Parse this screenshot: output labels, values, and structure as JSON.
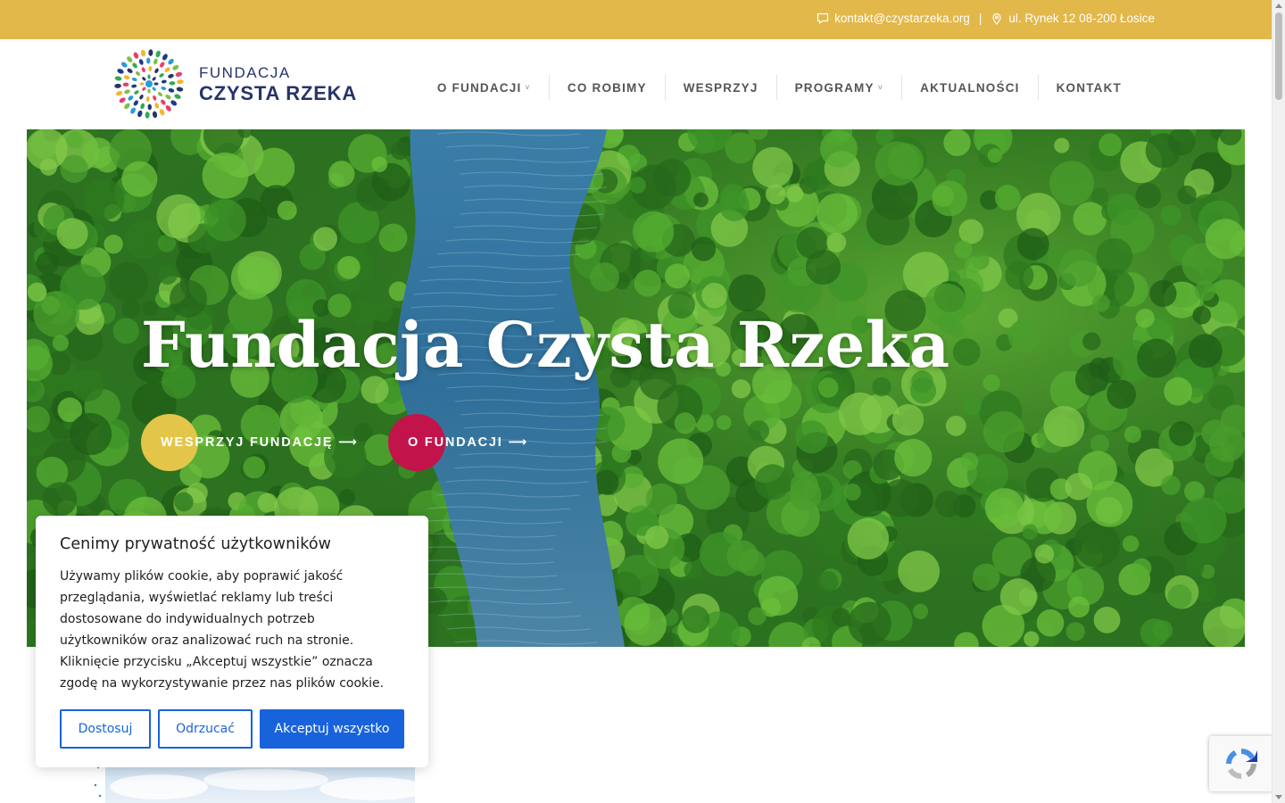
{
  "topbar": {
    "email": "kontakt@czystarzeka.org",
    "separator": "|",
    "address": "ul. Rynek 12 08-200 Łosice",
    "email_icon": "chat-bubble-icon",
    "address_icon": "map-pin-icon",
    "color": "#e2b84a"
  },
  "logo": {
    "line1": "FUNDACJA",
    "line2": "CZYSTA RZEKA"
  },
  "nav": {
    "items": [
      {
        "label": "O FUNDACJI",
        "has_dropdown": true
      },
      {
        "label": "CO ROBIMY",
        "has_dropdown": false
      },
      {
        "label": "WESPRZYJ",
        "has_dropdown": false
      },
      {
        "label": "PROGRAMY",
        "has_dropdown": true
      },
      {
        "label": "AKTUALNOŚCI",
        "has_dropdown": false
      },
      {
        "label": "KONTAKT",
        "has_dropdown": false
      }
    ],
    "dropdown_glyph": "˅"
  },
  "hero": {
    "title": "Fundacja Czysta Rzeka",
    "buttons": [
      {
        "label": "WESPRZYJ FUNDACJĘ ⟶",
        "color": "#e3c649"
      },
      {
        "label": "O FUNDACJI ⟶",
        "color": "#c2144b"
      }
    ]
  },
  "cookie": {
    "title": "Cenimy prywatność użytkowników",
    "text": "Używamy plików cookie, aby poprawić jakość przeglądania, wyświetlać reklamy lub treści dostosowane do indywidualnych potrzeb użytkowników oraz analizować ruch na stronie. Kliknięcie przycisku „Akceptuj wszystkie” oznacza zgodę na wykorzystywanie przez nas plików cookie.",
    "btn_customize": "Dostosuj",
    "btn_reject": "Odrzucać",
    "btn_accept": "Akceptuj wszystko",
    "accent": "#1863dc"
  },
  "recaptcha": {
    "icon": "recaptcha-icon"
  }
}
